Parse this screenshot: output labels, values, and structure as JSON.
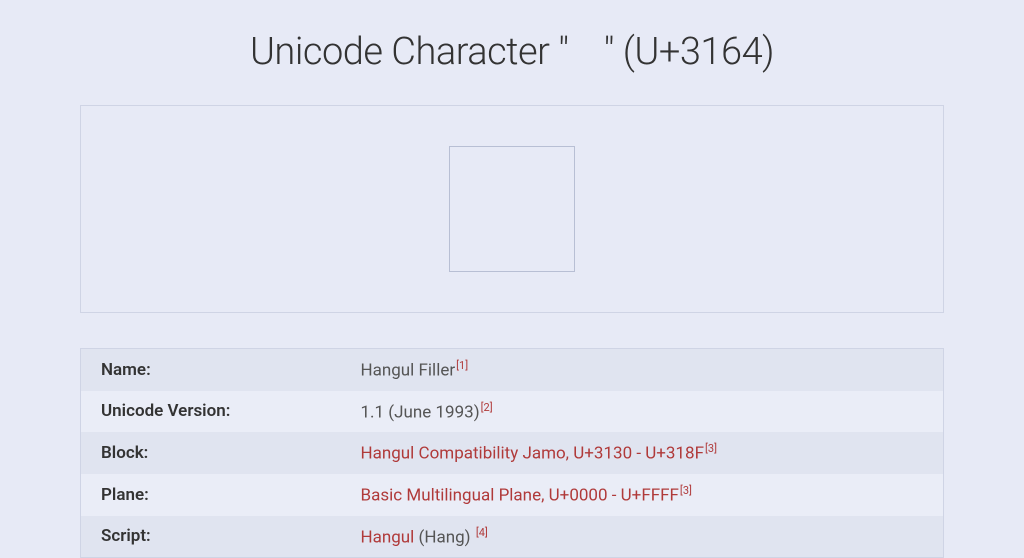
{
  "title": "Unicode Character \"ㅤ\" (U+3164)",
  "displayed_char": "ㅤ",
  "properties": [
    {
      "label": "Name:",
      "value_plain": "Hangul Filler",
      "value_link": "",
      "value_suffix": "",
      "ref": "[1]",
      "is_link": false
    },
    {
      "label": "Unicode Version:",
      "value_plain": "1.1 (June 1993)",
      "value_link": "",
      "value_suffix": "",
      "ref": "[2]",
      "is_link": false
    },
    {
      "label": "Block:",
      "value_plain": "",
      "value_link": "Hangul Compatibility Jamo, U+3130 - U+318F",
      "value_suffix": "",
      "ref": "[3]",
      "is_link": true
    },
    {
      "label": "Plane:",
      "value_plain": "",
      "value_link": "Basic Multilingual Plane, U+0000 - U+FFFF",
      "value_suffix": "",
      "ref": "[3]",
      "is_link": true
    },
    {
      "label": "Script:",
      "value_plain": "",
      "value_link": "Hangul",
      "value_suffix": " (Hang) ",
      "ref": "[4]",
      "is_link": true
    }
  ]
}
